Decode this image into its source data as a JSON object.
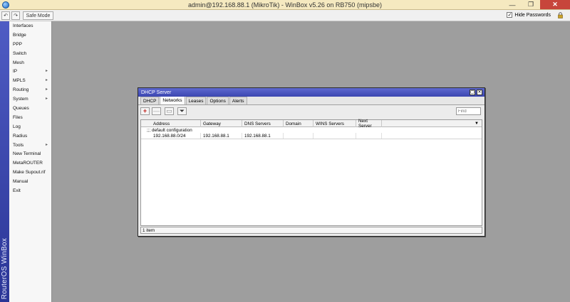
{
  "window": {
    "title": "admin@192.168.88.1 (MikroTik) - WinBox v5.26 on RB750 (mipsbe)",
    "minimize": "—",
    "maximize": "❐",
    "close": "✕"
  },
  "toolbar": {
    "undo": "↶",
    "redo": "↷",
    "safe_mode": "Safe Mode",
    "hide_passwords": "Hide Passwords",
    "hide_passwords_checked": "✓"
  },
  "brand": "RouterOS WinBox",
  "sidebar": {
    "items": [
      {
        "label": "Interfaces",
        "arrow": ""
      },
      {
        "label": "Bridge",
        "arrow": ""
      },
      {
        "label": "PPP",
        "arrow": ""
      },
      {
        "label": "Switch",
        "arrow": ""
      },
      {
        "label": "Mesh",
        "arrow": ""
      },
      {
        "label": "IP",
        "arrow": "▸"
      },
      {
        "label": "MPLS",
        "arrow": "▸"
      },
      {
        "label": "Routing",
        "arrow": "▸"
      },
      {
        "label": "System",
        "arrow": "▸"
      },
      {
        "label": "Queues",
        "arrow": ""
      },
      {
        "label": "Files",
        "arrow": ""
      },
      {
        "label": "Log",
        "arrow": ""
      },
      {
        "label": "Radius",
        "arrow": ""
      },
      {
        "label": "Tools",
        "arrow": "▸"
      },
      {
        "label": "New Terminal",
        "arrow": ""
      },
      {
        "label": "MetaROUTER",
        "arrow": ""
      },
      {
        "label": "Make Supout.rif",
        "arrow": ""
      },
      {
        "label": "Manual",
        "arrow": ""
      },
      {
        "label": "Exit",
        "arrow": ""
      }
    ]
  },
  "dialog": {
    "title": "DHCP Server",
    "restore": "▢",
    "close": "✕",
    "tabs": [
      "DHCP",
      "Networks",
      "Leases",
      "Options",
      "Alerts"
    ],
    "active_tab": "Networks",
    "add_symbol": "+",
    "remove_symbol": "—",
    "comment_symbol": "▭",
    "filter_symbol": "⏷",
    "find_placeholder": "Find",
    "columns": [
      "Address",
      "Gateway",
      "DNS Servers",
      "Domain",
      "WINS Servers",
      "Next Server"
    ],
    "sort_symbol": "▼",
    "group_comment": ";;; default configuration",
    "rows": [
      {
        "address": "192.168.88.0/24",
        "gateway": "192.168.88.1",
        "dns": "192.168.88.1",
        "domain": "",
        "wins": "",
        "next_server": ""
      }
    ],
    "status": "1 item"
  }
}
